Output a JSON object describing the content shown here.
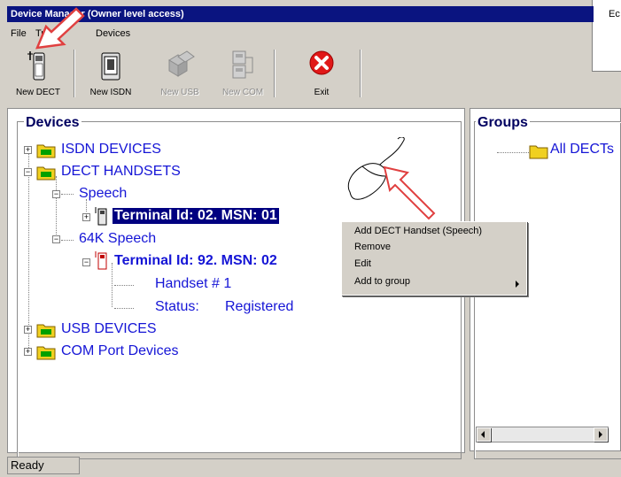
{
  "window": {
    "title": "Device Manager (Owner level access)",
    "colors": {
      "titlebar": "#0a1480",
      "face": "#d4d0c8",
      "selection": "#000080",
      "tree_text": "#1515d6"
    }
  },
  "menu": {
    "items": [
      "File",
      "Tra",
      "Devices"
    ]
  },
  "toolbar": {
    "buttons": [
      {
        "label": "New DECT",
        "icon": "dect-phone-icon",
        "enabled": true
      },
      {
        "label": "New ISDN",
        "icon": "isdn-phone-icon",
        "enabled": true
      },
      {
        "label": "New USB",
        "icon": "usb-device-icon",
        "enabled": false
      },
      {
        "label": "New COM",
        "icon": "com-device-icon",
        "enabled": false
      },
      {
        "label": "Exit",
        "icon": "exit-icon",
        "enabled": true
      }
    ]
  },
  "devices": {
    "heading": "Devices",
    "nodes": {
      "isdn": "ISDN DEVICES",
      "dect": "DECT HANDSETS",
      "speech": "Speech",
      "terminal1": "Terminal Id: 02. MSN: 01",
      "speech64k": "64K Speech",
      "terminal2": "Terminal Id: 92. MSN: 02",
      "handset": "Handset # 1",
      "status_label": "Status:",
      "status_value": "Registered",
      "usb": "USB DEVICES",
      "com": "COM Port Devices"
    }
  },
  "groups": {
    "heading": "Groups",
    "items": [
      "All DECTs"
    ]
  },
  "context_menu": {
    "items": [
      "Add DECT Handset (Speech)",
      "Remove",
      "Edit",
      "Add to group"
    ]
  },
  "popup": {
    "text": "Ec"
  },
  "status": {
    "text": "Ready"
  }
}
